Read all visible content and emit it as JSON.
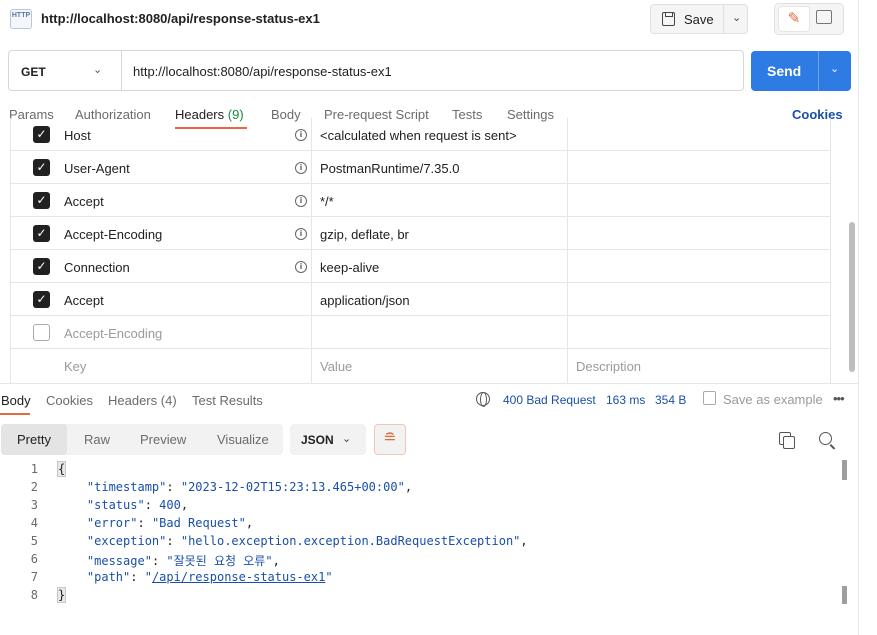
{
  "header": {
    "http_badge": "HTTP",
    "title": "http://localhost:8080/api/response-status-ex1",
    "save_label": "Save"
  },
  "request": {
    "method": "GET",
    "url": "http://localhost:8080/api/response-status-ex1",
    "send_label": "Send"
  },
  "request_tabs": {
    "params": "Params",
    "authorization": "Authorization",
    "headers": "Headers",
    "headers_count": "(9)",
    "body": "Body",
    "prerequest": "Pre-request Script",
    "tests": "Tests",
    "settings": "Settings",
    "cookies": "Cookies"
  },
  "headers_table": {
    "rows": [
      {
        "key": "Host",
        "value": "<calculated when request is sent>",
        "checked": true
      },
      {
        "key": "User-Agent",
        "value": "PostmanRuntime/7.35.0",
        "checked": true
      },
      {
        "key": "Accept",
        "value": "*/*",
        "checked": true
      },
      {
        "key": "Accept-Encoding",
        "value": "gzip, deflate, br",
        "checked": true
      },
      {
        "key": "Connection",
        "value": "keep-alive",
        "checked": true
      },
      {
        "key": "Accept",
        "value": "application/json",
        "checked": true
      },
      {
        "key": "Accept-Encoding",
        "value": "",
        "checked": false
      }
    ],
    "placeholder_key": "Key",
    "placeholder_value": "Value",
    "placeholder_desc": "Description"
  },
  "response_tabs": {
    "body": "Body",
    "cookies": "Cookies",
    "headers": "Headers",
    "headers_count": "(4)",
    "test_results": "Test Results",
    "status": "400 Bad Request",
    "time": "163 ms",
    "size": "354 B",
    "save_example": "Save as example"
  },
  "viewer": {
    "pretty": "Pretty",
    "raw": "Raw",
    "preview": "Preview",
    "visualize": "Visualize",
    "format": "JSON"
  },
  "body": {
    "line_numbers": [
      "1",
      "2",
      "3",
      "4",
      "5",
      "6",
      "7",
      "8"
    ],
    "open": "{",
    "close": "}",
    "fields": [
      {
        "key": "\"timestamp\"",
        "value": "\"2023-12-02T15:23:13.465+00:00\"",
        "sep": ","
      },
      {
        "key": "\"status\"",
        "value": "400",
        "sep": ","
      },
      {
        "key": "\"error\"",
        "value": "\"Bad Request\"",
        "sep": ","
      },
      {
        "key": "\"exception\"",
        "value": "\"hello.exception.exception.BadRequestException\"",
        "sep": ","
      },
      {
        "key": "\"message\"",
        "value": "\"잘못된 요청 오류\"",
        "sep": ","
      },
      {
        "key": "\"path\"",
        "value_pre": "\"",
        "value_link": "/api/response-status-ex1",
        "value_post": "\"",
        "sep": ""
      }
    ]
  },
  "colors": {
    "accent": "#e5693a",
    "send": "#2e7be4",
    "link": "#1a4fa8",
    "headers_count": "#1b8a3d"
  }
}
